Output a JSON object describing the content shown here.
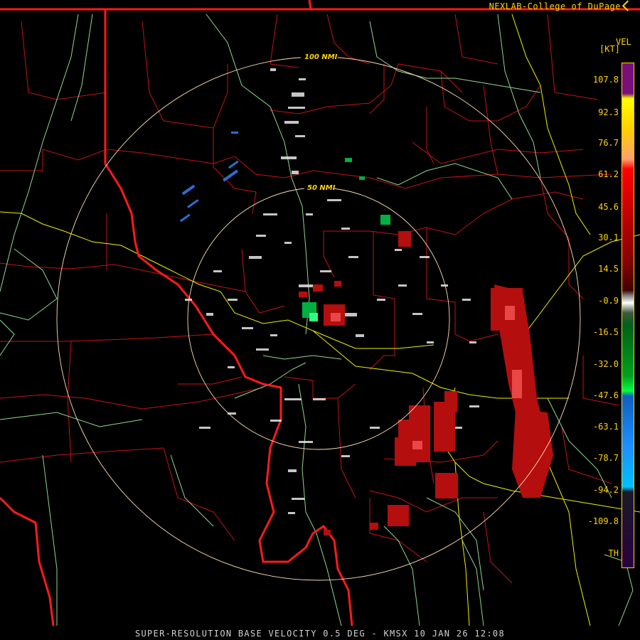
{
  "header": {
    "credit": "NEXLAB-College of DuPage"
  },
  "icons": {
    "credit_icon": "external-link-icon"
  },
  "radar": {
    "station": "KMSX",
    "range_rings": [
      {
        "label": "50 NMI"
      },
      {
        "label": "100 NMI"
      }
    ]
  },
  "legend": {
    "title": "VEL",
    "unit": "[KT]",
    "ticks": [
      "107.8",
      "92.3",
      "76.7",
      "61.2",
      "45.6",
      "30.1",
      "14.5",
      "-0.9",
      "-16.5",
      "-32.0",
      "-47.6",
      "-63.1",
      "-78.7",
      "-94.2",
      "-109.8",
      "TH"
    ]
  },
  "footer": {
    "caption": "SUPER-RESOLUTION BASE VELOCITY 0.5 DEG - KMSX 10 JAN 26 12:08"
  },
  "colors": {
    "background": "#000000",
    "state_border": "#ff1a1a",
    "county_border": "#c81414",
    "river": "#8fd88f",
    "highway": "#f0f000",
    "range_ring": "#ffe0b0",
    "label": "#ffd400",
    "inbound_velocity": "#00c040",
    "outbound_velocity": "#c81414"
  }
}
